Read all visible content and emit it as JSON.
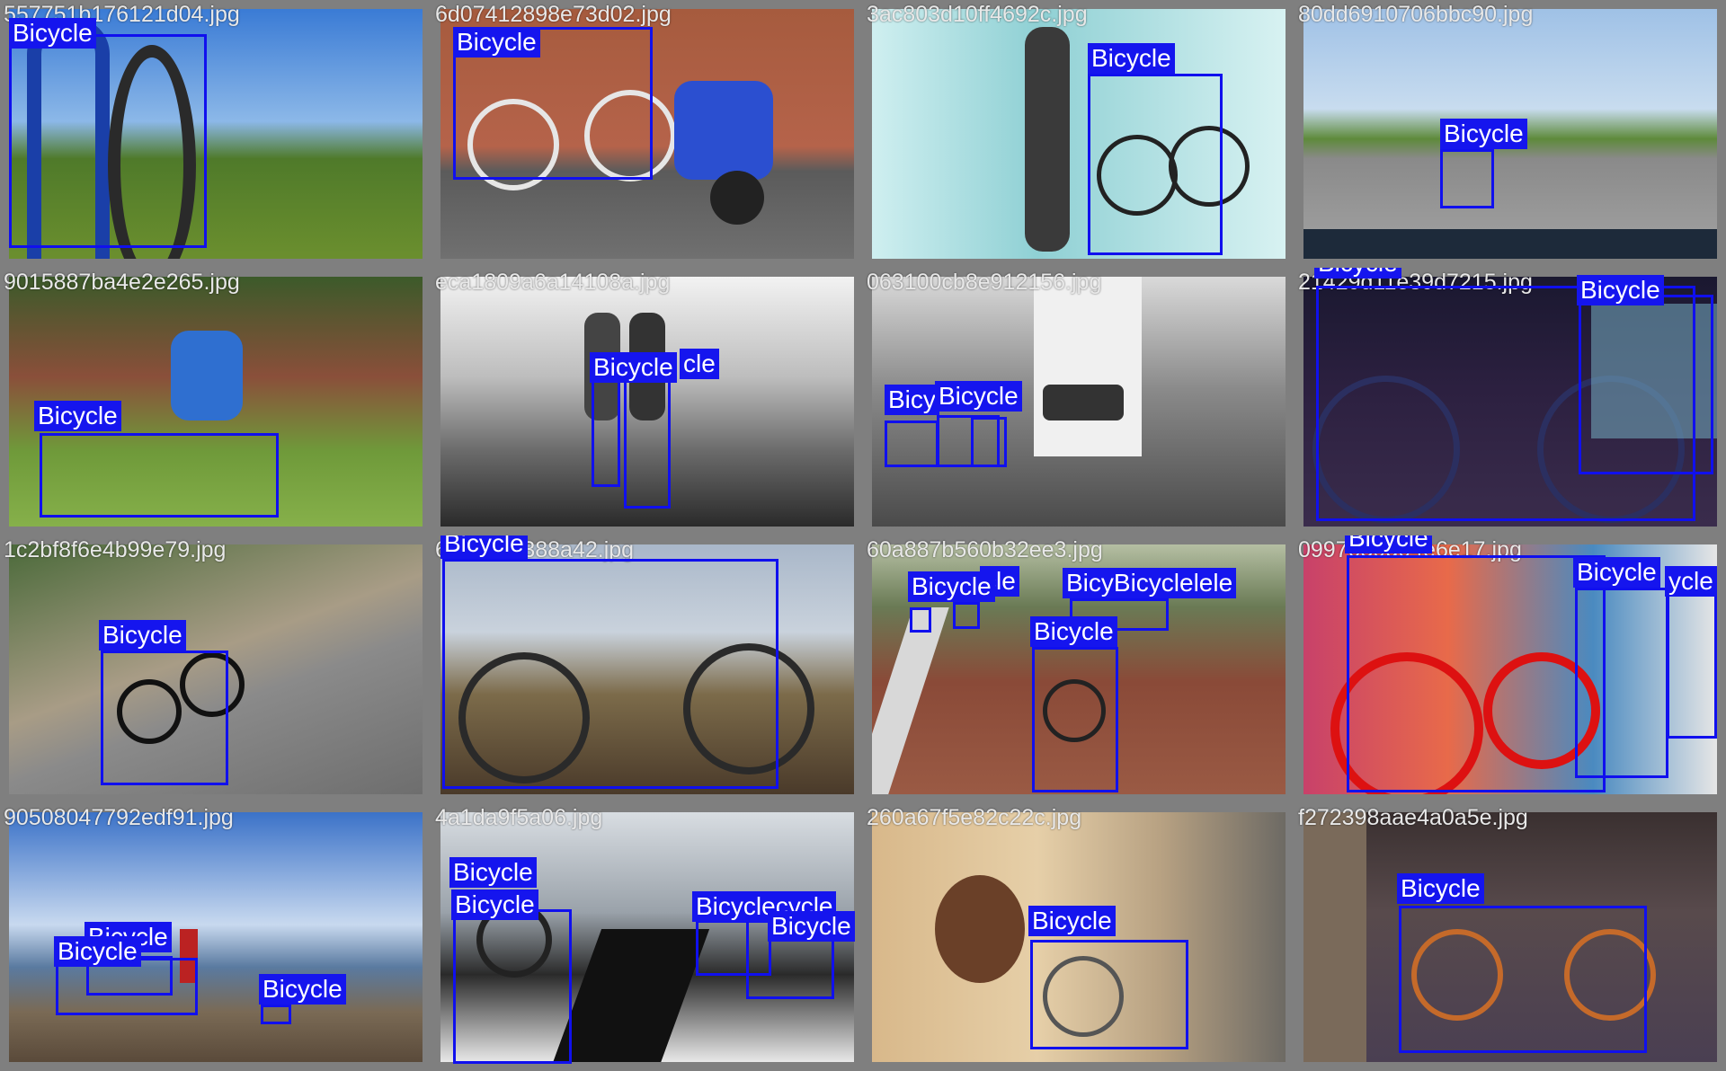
{
  "colors": {
    "box": "#1010ee",
    "label_bg": "#1515ee",
    "label_text": "#ffffff",
    "border": "#7f7f7f"
  },
  "class_name": "Bicycle",
  "tiles": [
    {
      "filename": "557751b176121d04.jpg",
      "labels": [
        "Bicycle"
      ]
    },
    {
      "filename": "6d07412898e73d02.jpg",
      "labels": [
        "Bicycle"
      ]
    },
    {
      "filename": "3ac803d10ff4692c.jpg",
      "labels": [
        "Bicycle"
      ]
    },
    {
      "filename": "80dd6910706bbc90.jpg",
      "labels": [
        "Bicycle"
      ]
    },
    {
      "filename": "9015887ba4e2e265.jpg",
      "labels": [
        "Bicycle"
      ]
    },
    {
      "filename": "eca1809a6a14108a.jpg",
      "labels": [
        "Bicycle",
        "cle"
      ]
    },
    {
      "filename": "063100cb8e912156.jpg",
      "labels": [
        "Bicy",
        "Bicycle"
      ]
    },
    {
      "filename": "21429d11e39d7215.jpg",
      "labels": [
        "Bicycle",
        "Bicycle"
      ]
    },
    {
      "filename": "1c2bf8f6e4b99e79.jpg",
      "labels": [
        "Bicycle"
      ]
    },
    {
      "filename": "6ee4aed388a42.jpg",
      "labels": [
        "Bicycle"
      ]
    },
    {
      "filename": "60a887b560b32ee3.jpg",
      "labels": [
        "Bicycle",
        "cle",
        "BicyBicyclelele",
        "Bicycle"
      ]
    },
    {
      "filename": "0997059d04e6e17.jpg",
      "labels": [
        "Bicycle",
        "Bicycle",
        "ycle"
      ]
    },
    {
      "filename": "90508047792edf91.jpg",
      "labels": [
        "Bicycle",
        "Bicycle",
        "Bicycle"
      ]
    },
    {
      "filename": "4a1da9f5a06.jpg",
      "labels": [
        "Bicycle",
        "Bicycle",
        "Bicyclecycle",
        "Bicycle"
      ]
    },
    {
      "filename": "260a67f5e82c22c.jpg",
      "labels": [
        "Bicycle"
      ]
    },
    {
      "filename": "f272398aae4a0a5e.jpg",
      "labels": [
        "Bicycle"
      ]
    }
  ]
}
